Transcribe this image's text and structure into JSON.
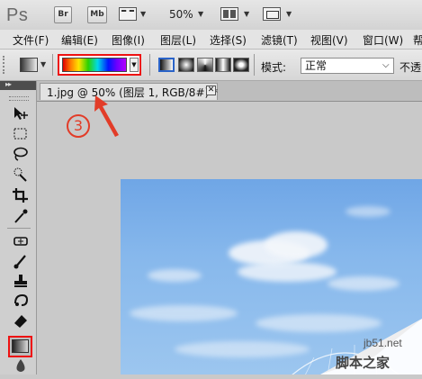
{
  "app": {
    "logo": "Ps",
    "bridge_btn": "Br",
    "minibridge_btn": "Mb",
    "zoom": "50%"
  },
  "menu": [
    "文件(F)",
    "编辑(E)",
    "图像(I)",
    "图层(L)",
    "选择(S)",
    "滤镜(T)",
    "视图(V)",
    "窗口(W)",
    "帮"
  ],
  "options": {
    "mode_label": "模式:",
    "mode_value": "正常",
    "opacity_label": "不透"
  },
  "document": {
    "tab_title": "1.jpg @ 50% (图层 1, RGB/8#) *",
    "close": "✕"
  },
  "annotation": {
    "step": "3"
  },
  "watermark": {
    "line1": "jb51.net",
    "line2": "脚本之家"
  },
  "colors": {
    "highlight": "#e11111",
    "annotation": "#e23c28"
  }
}
